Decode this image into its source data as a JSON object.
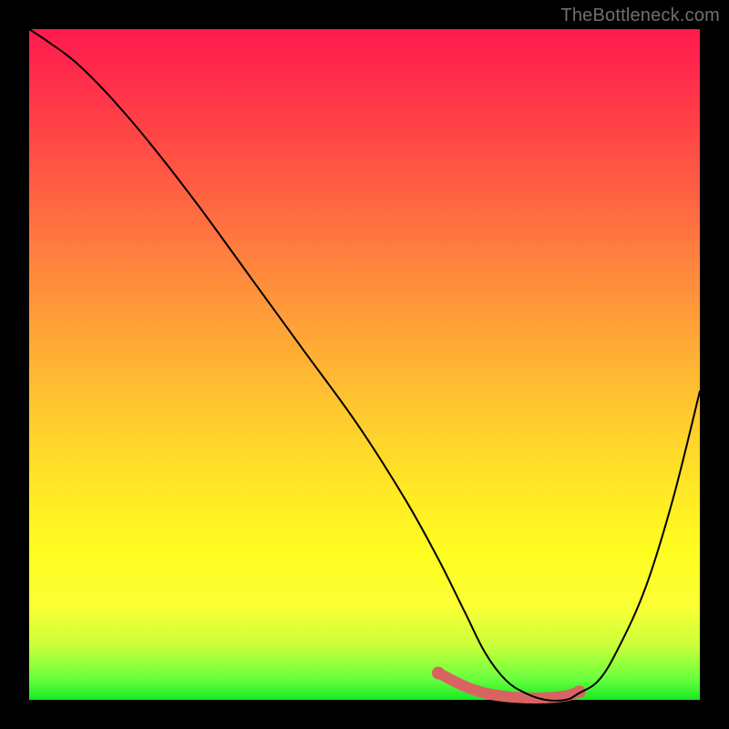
{
  "watermark": "TheBottleneck.com",
  "colors": {
    "background": "#000000",
    "gradient_top": "#ff1a4d",
    "gradient_bottom": "#18e822",
    "curve": "#000000",
    "highlight": "#d96363",
    "watermark_text": "#6f6f6f"
  },
  "chart_data": {
    "type": "line",
    "title": "",
    "xlabel": "",
    "ylabel": "",
    "xlim": [
      0,
      100
    ],
    "ylim": [
      0,
      100
    ],
    "grid": false,
    "legend": false,
    "series": [
      {
        "name": "bottleneck-curve",
        "x": [
          0,
          3,
          7,
          12,
          18,
          25,
          33,
          41,
          49,
          56,
          61,
          65,
          68,
          71,
          74,
          77,
          80,
          82,
          85,
          88,
          92,
          96,
          100
        ],
        "y": [
          100,
          98,
          95,
          90,
          83,
          74,
          63,
          52,
          41,
          30,
          21,
          13,
          7,
          3,
          1,
          0,
          0,
          1,
          3,
          8,
          17,
          30,
          46
        ]
      }
    ],
    "highlight": {
      "name": "optimal-range",
      "x": [
        61,
        65,
        68,
        71,
        74,
        77,
        80,
        82
      ],
      "y": [
        4,
        2,
        1,
        0.5,
        0.3,
        0.3,
        0.6,
        1.2
      ]
    },
    "annotations": []
  }
}
